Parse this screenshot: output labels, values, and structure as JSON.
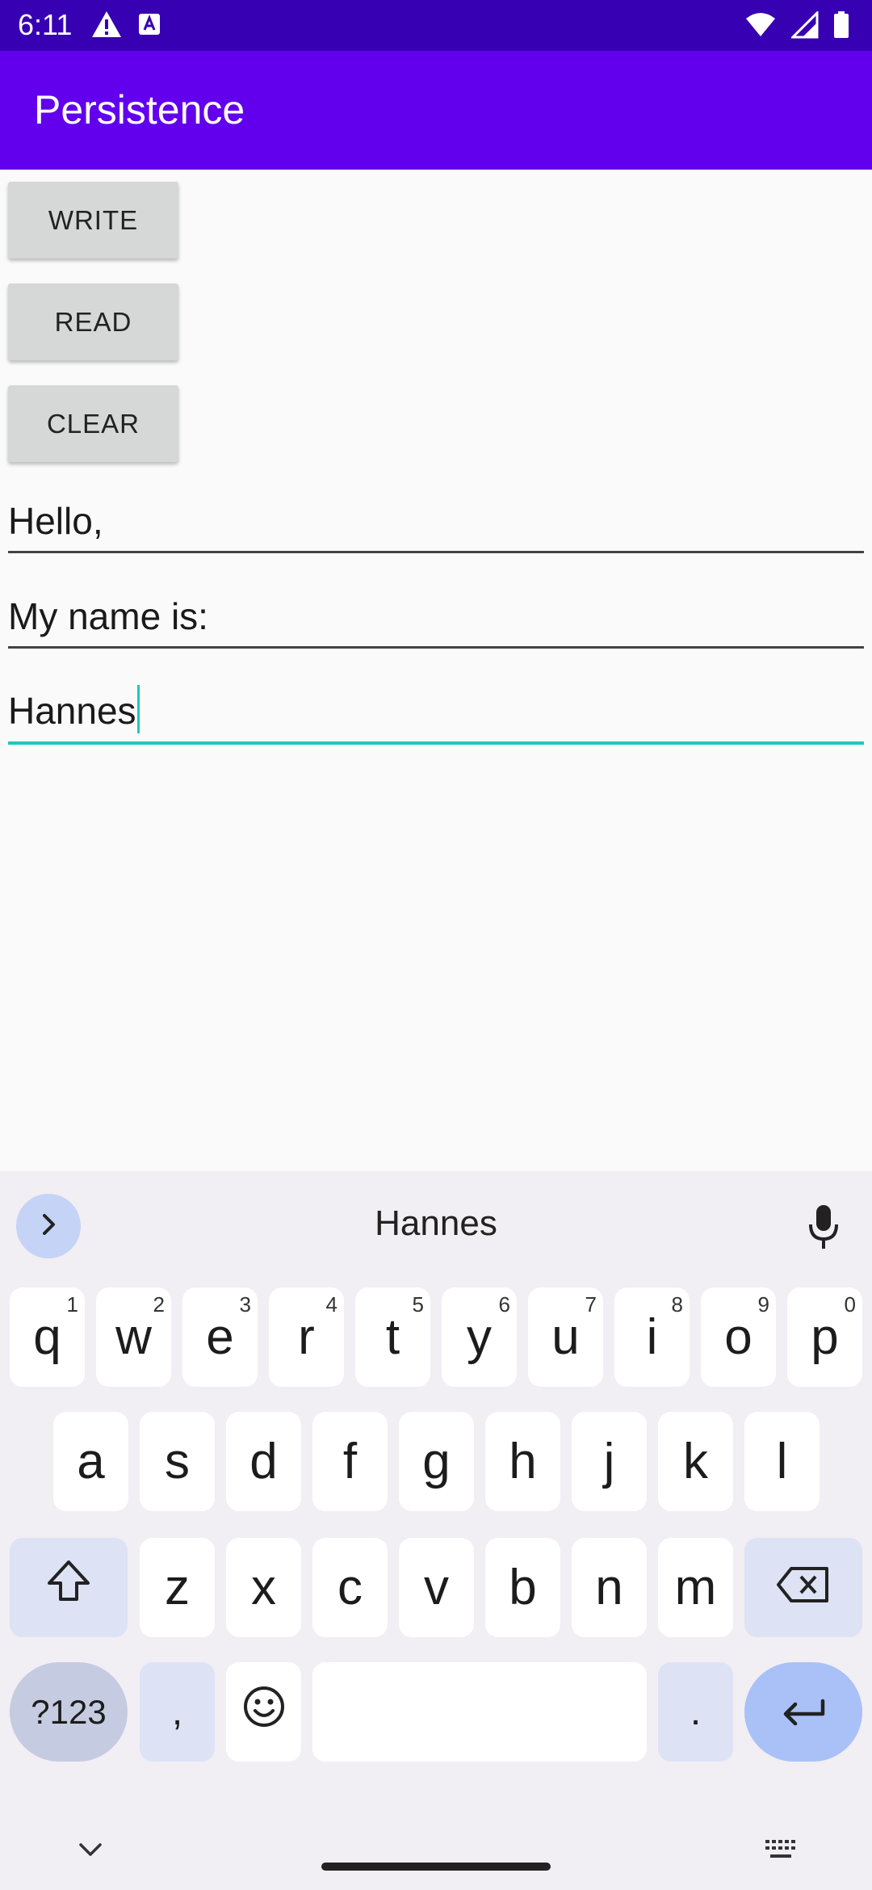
{
  "status_bar": {
    "time": "6:11"
  },
  "app_bar": {
    "title": "Persistence"
  },
  "buttons": {
    "write": "WRITE",
    "read": "READ",
    "clear": "CLEAR"
  },
  "fields": [
    {
      "value": "Hello,"
    },
    {
      "value": "My name is:"
    },
    {
      "value": "Hannes"
    }
  ],
  "keyboard": {
    "suggestion": "Hannes",
    "row1": [
      {
        "label": "q",
        "hint": "1"
      },
      {
        "label": "w",
        "hint": "2"
      },
      {
        "label": "e",
        "hint": "3"
      },
      {
        "label": "r",
        "hint": "4"
      },
      {
        "label": "t",
        "hint": "5"
      },
      {
        "label": "y",
        "hint": "6"
      },
      {
        "label": "u",
        "hint": "7"
      },
      {
        "label": "i",
        "hint": "8"
      },
      {
        "label": "o",
        "hint": "9"
      },
      {
        "label": "p",
        "hint": "0"
      }
    ],
    "row2": [
      "a",
      "s",
      "d",
      "f",
      "g",
      "h",
      "j",
      "k",
      "l"
    ],
    "row3": [
      "z",
      "x",
      "c",
      "v",
      "b",
      "n",
      "m"
    ],
    "symbols_label": "?123",
    "comma": ",",
    "period": "."
  },
  "colors": {
    "status_bar": "#3700b3",
    "app_bar": "#6200ee",
    "field_focus": "#20c7c0",
    "keyboard_bg": "#f1eef4"
  }
}
